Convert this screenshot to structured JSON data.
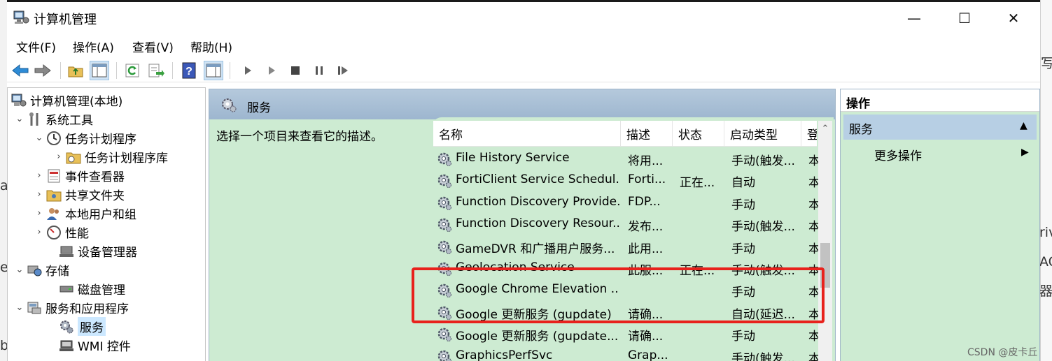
{
  "window": {
    "title": "计算机管理",
    "controls": {
      "minimize": "—",
      "maximize": "☐",
      "close": "✕"
    }
  },
  "menu": [
    "文件(F)",
    "操作(A)",
    "查看(V)",
    "帮助(H)"
  ],
  "tree": {
    "items": [
      {
        "label": "计算机管理(本地)",
        "expander": ""
      },
      {
        "label": "系统工具",
        "expander": "⌄"
      },
      {
        "label": "任务计划程序",
        "expander": "⌄"
      },
      {
        "label": "任务计划程序库",
        "expander": "›"
      },
      {
        "label": "事件查看器",
        "expander": "›"
      },
      {
        "label": "共享文件夹",
        "expander": "›"
      },
      {
        "label": "本地用户和组",
        "expander": "›"
      },
      {
        "label": "性能",
        "expander": "›"
      },
      {
        "label": "设备管理器",
        "expander": ""
      },
      {
        "label": "存储",
        "expander": "⌄"
      },
      {
        "label": "磁盘管理",
        "expander": ""
      },
      {
        "label": "服务和应用程序",
        "expander": "⌄"
      },
      {
        "label": "服务",
        "expander": ""
      },
      {
        "label": "WMI 控件",
        "expander": ""
      }
    ]
  },
  "main": {
    "header_title": "服务",
    "description_prompt": "选择一个项目来查看它的描述。",
    "columns": [
      "名称",
      "描述",
      "状态",
      "启动类型",
      "登"
    ],
    "rows": [
      {
        "name": "File History Service",
        "desc": "将用...",
        "status": "",
        "startup": "手动(触发...",
        "logon": "本"
      },
      {
        "name": "FortiClient Service Schedul...",
        "desc": "Forti...",
        "status": "正在...",
        "startup": "自动",
        "logon": "本"
      },
      {
        "name": "Function Discovery Provide...",
        "desc": "FDP...",
        "status": "",
        "startup": "手动",
        "logon": "本"
      },
      {
        "name": "Function Discovery Resour...",
        "desc": "发布...",
        "status": "",
        "startup": "手动(触发...",
        "logon": "本"
      },
      {
        "name": "GameDVR 和广播用户服务...",
        "desc": "此用...",
        "status": "",
        "startup": "手动",
        "logon": "本"
      },
      {
        "name": "Geolocation Service",
        "desc": "此服...",
        "status": "正在...",
        "startup": "手动(触发...",
        "logon": "本"
      },
      {
        "name": "Google Chrome Elevation ...",
        "desc": "",
        "status": "",
        "startup": "手动",
        "logon": "本"
      },
      {
        "name": "Google 更新服务 (gupdate)",
        "desc": "请确...",
        "status": "",
        "startup": "自动(延迟...",
        "logon": "本"
      },
      {
        "name": "Google 更新服务 (gupdate...",
        "desc": "请确...",
        "status": "",
        "startup": "手动",
        "logon": "本"
      },
      {
        "name": "GraphicsPerfSvc",
        "desc": "Grap...",
        "status": "",
        "startup": "手动(触发...",
        "logon": "本"
      }
    ]
  },
  "actions": {
    "header": "操作",
    "section": "服务",
    "more": "更多操作"
  },
  "watermark": "CSDN @皮卡丘_",
  "background_glyphs": [
    "写",
    "a",
    "e",
    "b",
    "riv",
    "AC",
    "器"
  ],
  "colors": {
    "pane_green": "#cdebd2",
    "header_blue": "#a6bdd4",
    "highlight_red": "#e8211c"
  }
}
